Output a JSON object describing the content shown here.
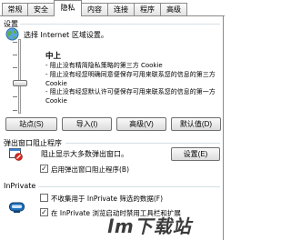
{
  "tabs": [
    {
      "label": "常规",
      "active": false
    },
    {
      "label": "安全",
      "active": false
    },
    {
      "label": "隐私",
      "active": true
    },
    {
      "label": "内容",
      "active": false
    },
    {
      "label": "连接",
      "active": false
    },
    {
      "label": "程序",
      "active": false
    },
    {
      "label": "高级",
      "active": false
    }
  ],
  "settings": {
    "group_label": "设置",
    "zone_prompt": "选择 Internet 区域设置。",
    "level_title": "中上",
    "descriptions": [
      "- 阻止没有精简隐私策略的第三方 Cookie",
      "- 阻止没有经您明确同意便保存可用来联系您的信息的第三方 Cookie",
      "- 阻止没有经您默认许可便保存可用来联系您的信息的第一方 Cookie"
    ],
    "buttons": {
      "sites": "站点(S)",
      "import": "导入(I)",
      "advanced": "高级(V)",
      "default": "默认值(D)"
    }
  },
  "popup": {
    "group_label": "弹出窗口阻止程序",
    "prevent_label": "阻止显示大多数弹出窗口。",
    "settings_button": "设置(E)",
    "enable_label": "启用弹出窗口阻止程序(B)",
    "enable_checked": true
  },
  "inprivate": {
    "group_label": "InPrivate",
    "no_collect_label": "不收集用于 InPrivate 筛选的数据(F)",
    "no_collect_checked": false,
    "disable_toolbar_label": "在 InPrivate 浏览启动时禁用工具栏和扩展",
    "disable_toolbar_checked": true
  },
  "watermark": "lm下载站"
}
